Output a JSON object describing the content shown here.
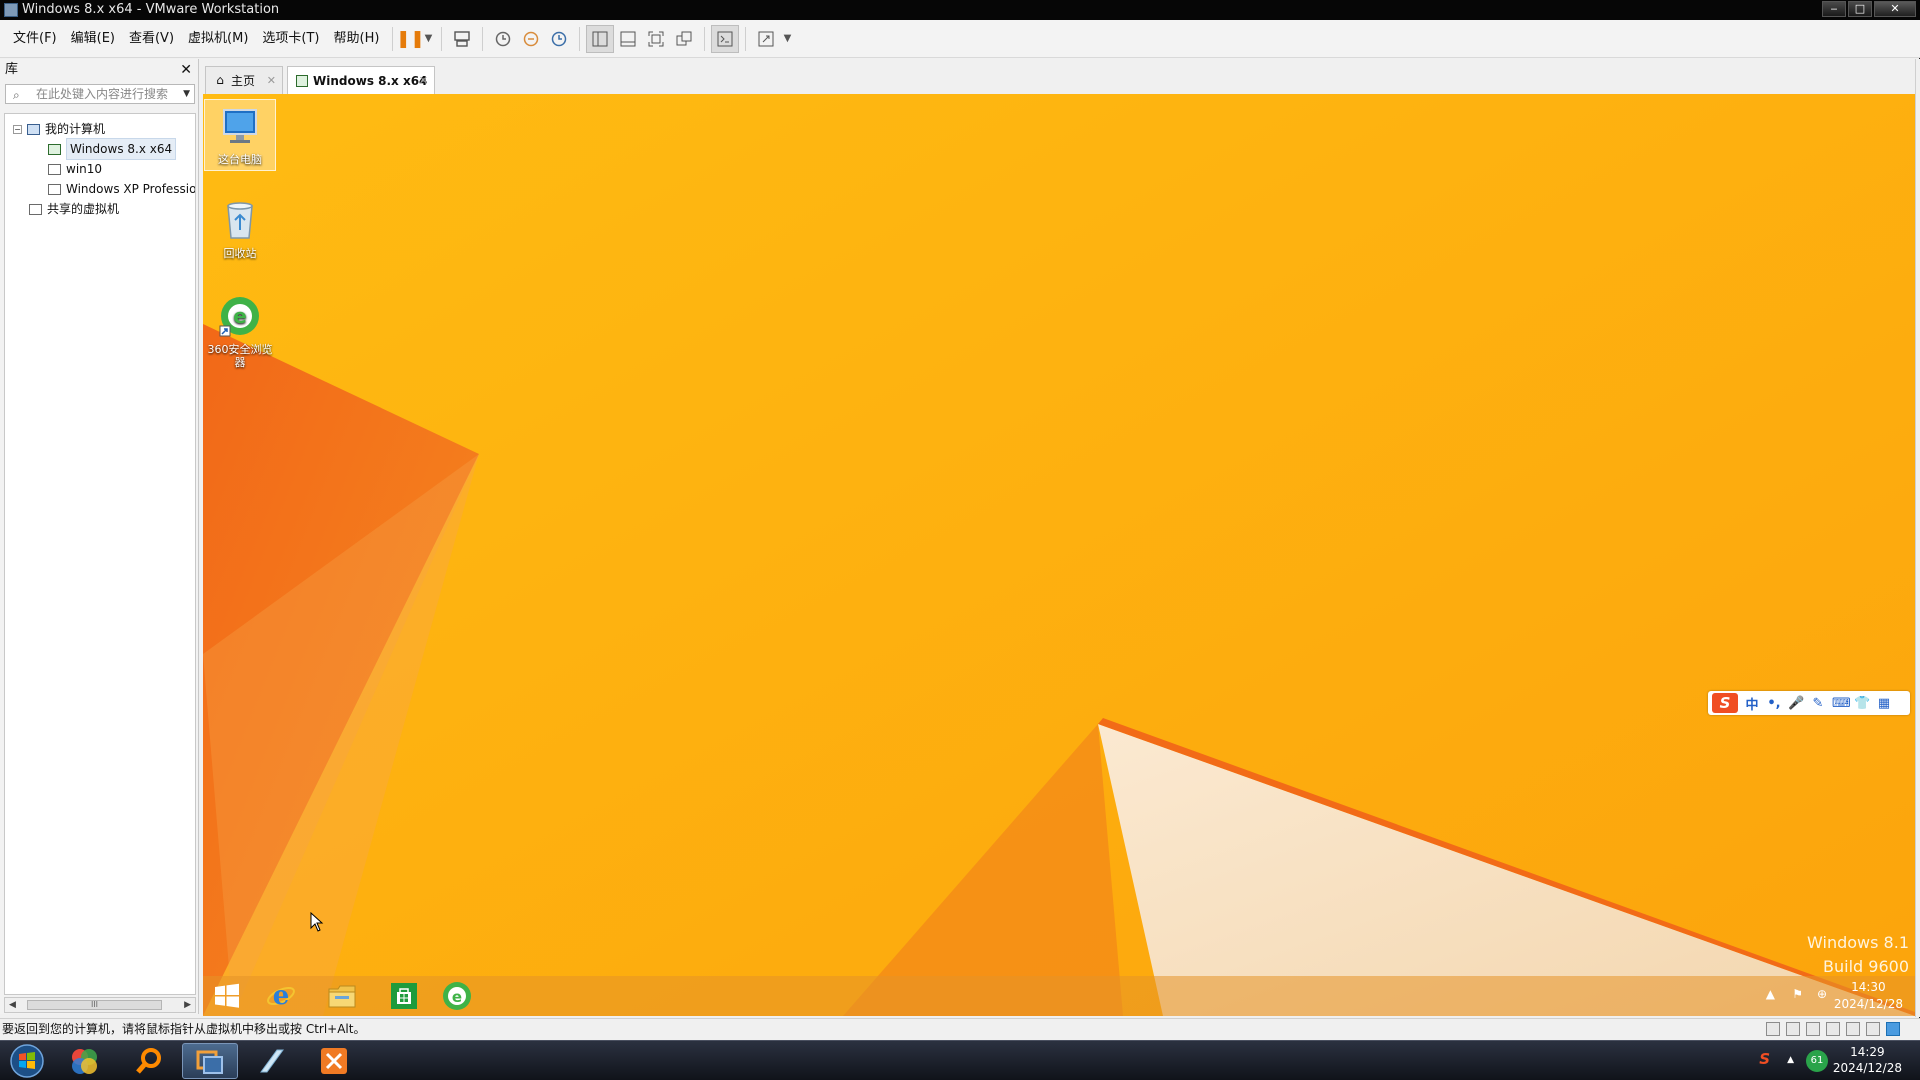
{
  "window": {
    "title": "Windows 8.x x64 - VMware Workstation",
    "min_label": "‒",
    "max_label": "□",
    "close_label": "✕"
  },
  "menu": {
    "items": [
      "文件(F)",
      "编辑(E)",
      "查看(V)",
      "虚拟机(M)",
      "选项卡(T)",
      "帮助(H)"
    ]
  },
  "library": {
    "title": "库",
    "close_label": "✕",
    "search_placeholder": "在此处键入内容进行搜索",
    "tree": {
      "my_computer": "我的计算机",
      "vms": [
        "Windows 8.x x64",
        "win10",
        "Windows XP Professio"
      ],
      "shared": "共享的虚拟机"
    },
    "scroll_thumb": "III"
  },
  "tabs": {
    "home": "主页",
    "vm": "Windows 8.x x64"
  },
  "guest": {
    "desktop_icons": [
      "这台电脑",
      "回收站",
      "360安全浏览器"
    ],
    "watermark_line1": "Windows 8.1",
    "watermark_line2": "Build 9600",
    "ime_labels": [
      "中",
      "•,",
      "🎤",
      "✎",
      "⌨",
      "👕",
      "▦"
    ],
    "ime_logo": "S",
    "taskbar_time": "14:30",
    "taskbar_date": "2024/12/28",
    "colors": {
      "wallpaper": "#ffb10c",
      "dark_orange": "#f26b17",
      "cream": "#f5e2c8"
    }
  },
  "status": {
    "message": "要返回到您的计算机，请将鼠标指针从虚拟机中移出或按 Ctrl+Alt。"
  },
  "host_taskbar": {
    "time": "14:29",
    "date": "2024/12/28",
    "badge": "61"
  }
}
